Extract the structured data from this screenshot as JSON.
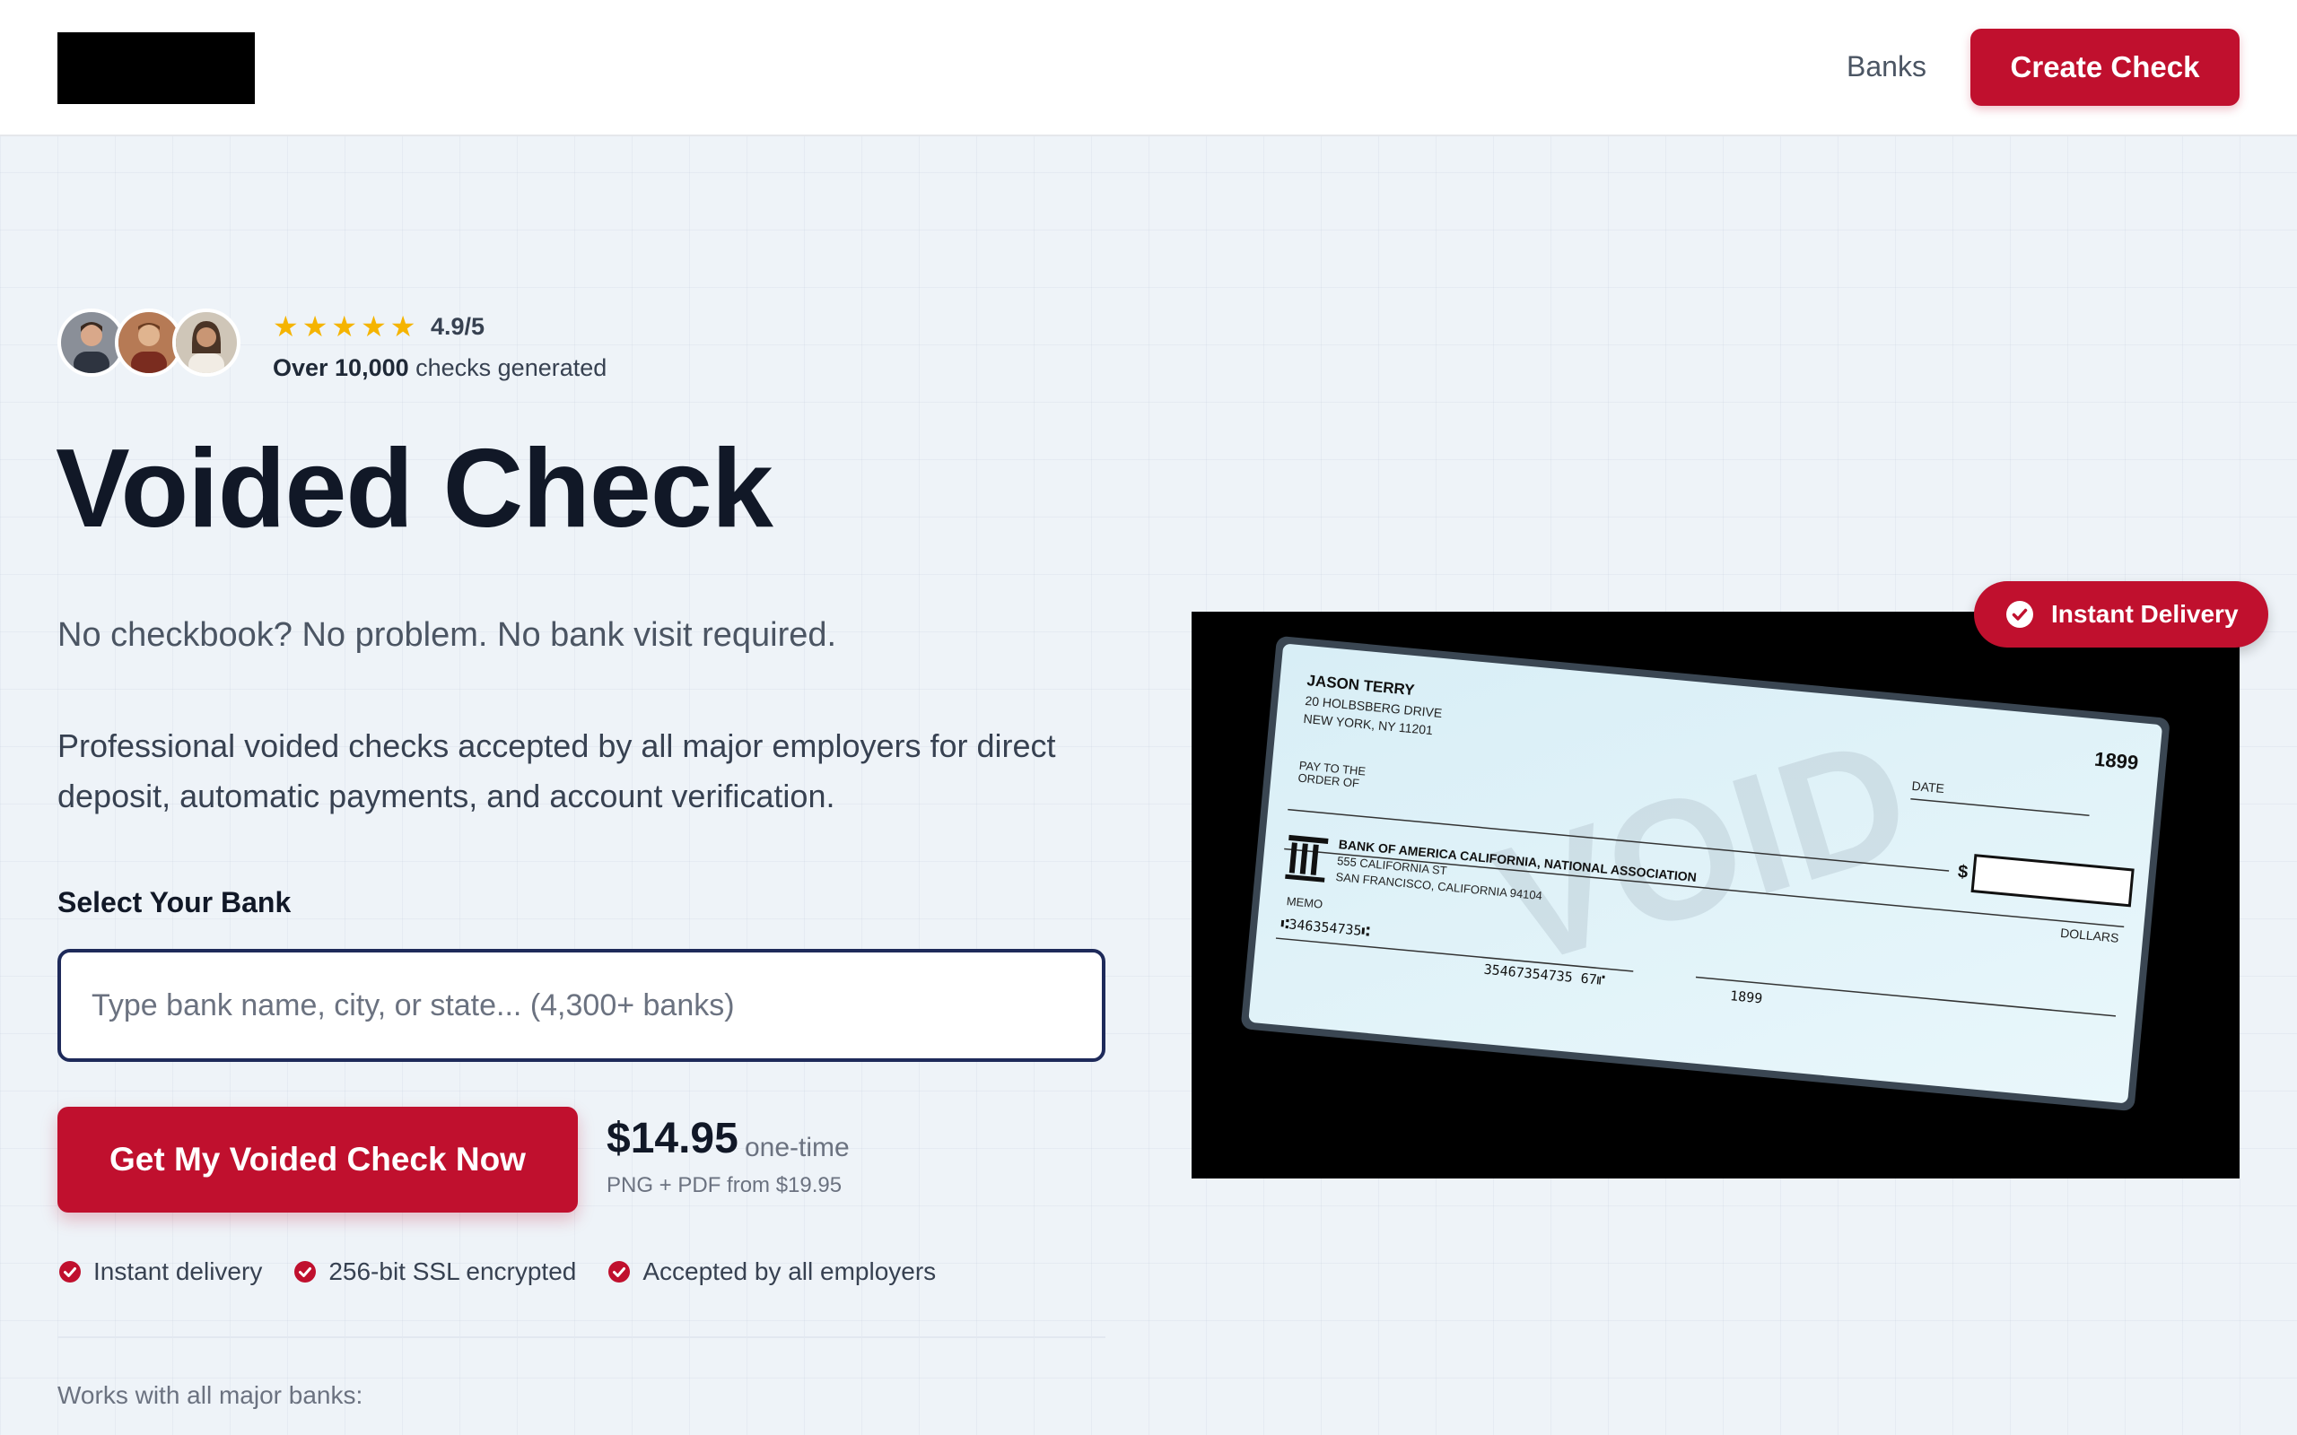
{
  "header": {
    "nav_banks": "Banks",
    "cta": "Create Check"
  },
  "social_proof": {
    "rating": "4.9/5",
    "stars": 5,
    "checks_bold": "Over 10,000",
    "checks_rest": " checks generated"
  },
  "hero": {
    "title": "Voided Check",
    "tagline": "No checkbook? No problem. No bank visit required.",
    "description": "Professional voided checks accepted by all major employers for direct deposit, automatic payments, and account verification."
  },
  "form": {
    "label": "Select Your Bank",
    "placeholder": "Type bank name, city, or state... (4,300+ banks)",
    "value": "",
    "cta": "Get My Voided Check Now"
  },
  "pricing": {
    "price": "$14.95",
    "note": "one-time",
    "sub": "PNG + PDF from $19.95"
  },
  "features": [
    "Instant delivery",
    "256-bit SSL encrypted",
    "Accepted by all employers"
  ],
  "works_with": "Works with all major banks:",
  "badge": "Instant Delivery",
  "check": {
    "name": "JASON TERRY",
    "address1": "20 HOLBSBERG DRIVE",
    "address2": "NEW YORK, NY 11201",
    "number": "1899",
    "date_label": "DATE",
    "pay_to_1": "PAY TO THE",
    "pay_to_2": "ORDER OF",
    "dollar_sign": "$",
    "dollars": "DOLLARS",
    "bank_name": "BANK OF AMERICA CALIFORNIA, NATIONAL ASSOCIATION",
    "bank_addr1": "555 CALIFORNIA ST",
    "bank_addr2": "SAN FRANCISCO, CALIFORNIA 94104",
    "memo": "MEMO",
    "routing": "⑆346354735⑆",
    "account": "35467354735 67⑈",
    "check_no": "1899",
    "void": "VOID"
  },
  "colors": {
    "brand_red": "#c0102e",
    "star": "#f5b400",
    "input_border": "#1e2a5a"
  }
}
